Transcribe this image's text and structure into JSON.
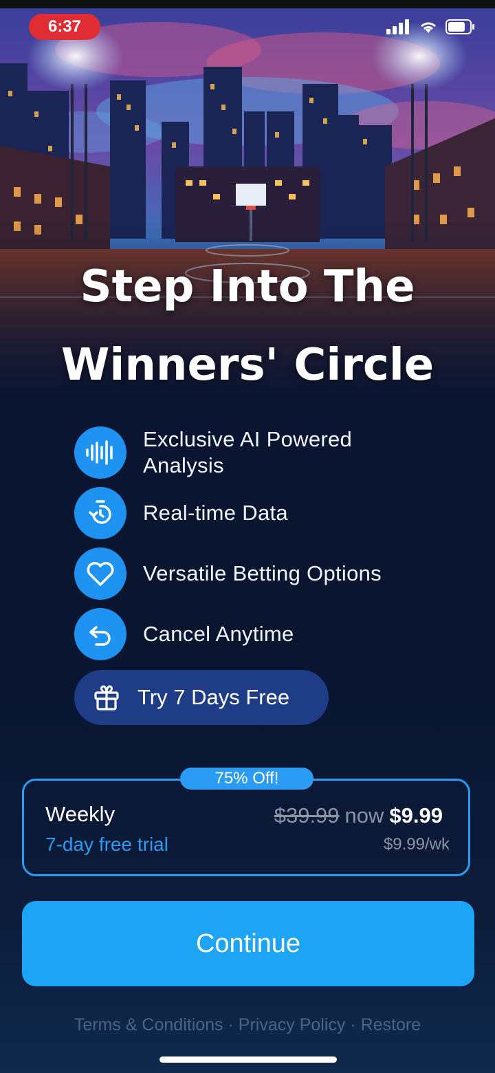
{
  "status_bar": {
    "time": "6:37"
  },
  "headline": {
    "line1": "Step Into The",
    "line2": "Winners' Circle"
  },
  "features": [
    {
      "icon": "waveform-icon",
      "label": "Exclusive AI Powered Analysis"
    },
    {
      "icon": "timer-icon",
      "label": "Real-time Data"
    },
    {
      "icon": "heart-icon",
      "label": "Versatile Betting Options"
    },
    {
      "icon": "undo-arrow-icon",
      "label": "Cancel Anytime"
    }
  ],
  "trial_pill": {
    "icon": "gift-icon",
    "label": "Try 7 Days Free"
  },
  "plan": {
    "badge": "75% Off!",
    "name": "Weekly",
    "trial": "7-day free trial",
    "old_price": "$39.99",
    "now_label": "now",
    "new_price": "$9.99",
    "per_week": "$9.99/wk"
  },
  "cta": {
    "label": "Continue"
  },
  "footer": {
    "terms": "Terms & Conditions",
    "sep1": "·",
    "privacy": "Privacy Policy",
    "sep2": "·",
    "restore": "Restore"
  },
  "colors": {
    "accent": "#1ea4f4",
    "badge": "#2a9cf3",
    "pill": "#1f3d86",
    "background": "#0b1633",
    "time_pill": "#e02d34"
  }
}
